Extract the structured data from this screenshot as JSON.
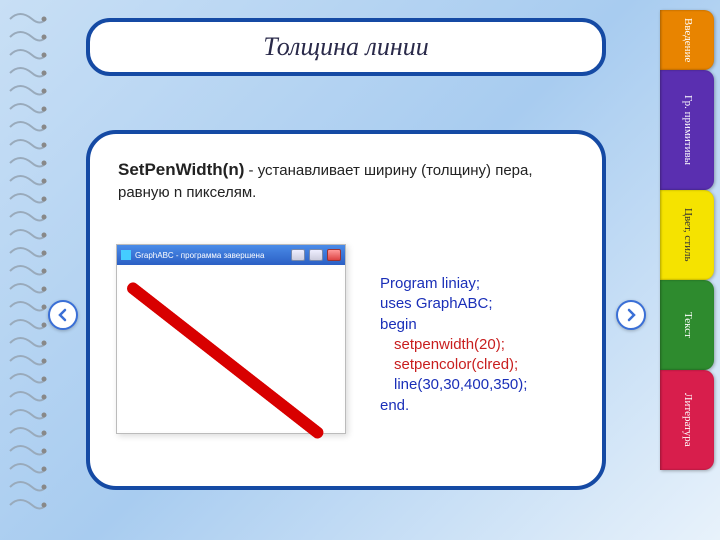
{
  "title": "Толщина линии",
  "desc": {
    "fn": "SetPenWidth(n)",
    "rest": " - устанавливает ширину (толщину) пера, равную n пикселям."
  },
  "screenshot": {
    "window_title": "GraphABC - программа завершена"
  },
  "code": {
    "l1": "Program liniay;",
    "l2": "uses GraphABC;",
    "l3": "begin",
    "l4": "setpenwidth(20);",
    "l5": "setpencolor(clred);",
    "l6": "line(30,30,400,350);",
    "l7": "end."
  },
  "tabs": {
    "t0": "Введение",
    "t1": "Гр. примитивы",
    "t2": "Цвет, стиль",
    "t3": "Текст",
    "t4": "Литература"
  }
}
